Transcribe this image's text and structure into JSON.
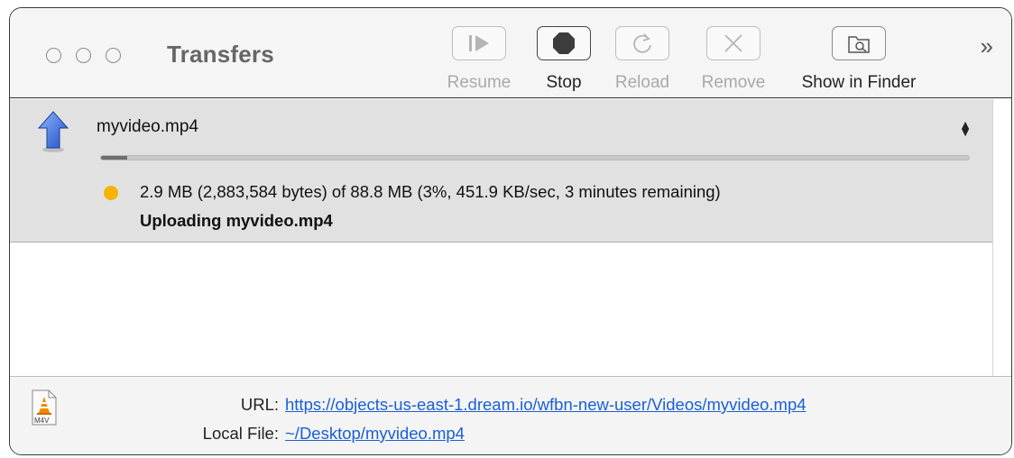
{
  "window": {
    "title": "Transfers"
  },
  "toolbar": {
    "resume_label": "Resume",
    "stop_label": "Stop",
    "reload_label": "Reload",
    "remove_label": "Remove",
    "show_in_finder_label": "Show in Finder",
    "overflow_glyph": "»"
  },
  "transfer": {
    "filename": "myvideo.mp4",
    "progress_percent": 3,
    "status": "2.9 MB (2,883,584 bytes) of 88.8 MB (3%, 451.9 KB/sec, 3 minutes remaining)",
    "substatus": "Uploading myvideo.mp4",
    "status_color": "#f5b400",
    "direction_icon": "upload-arrow-icon"
  },
  "details": {
    "url_label": "URL:",
    "url_value": "https://objects-us-east-1.dream.io/wfbn-new-user/Videos/myvideo.mp4",
    "local_label": "Local File:",
    "local_value": "~/Desktop/myvideo.mp4",
    "file_icon_badge": "M4V"
  }
}
